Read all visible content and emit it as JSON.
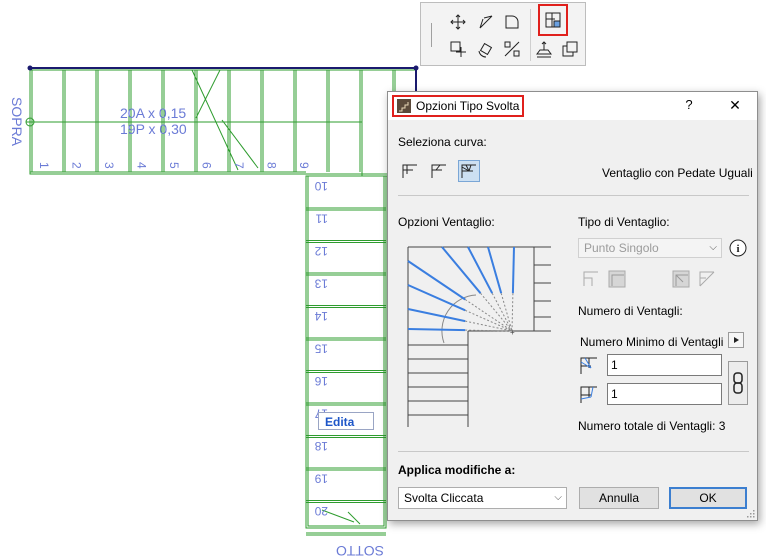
{
  "canvas": {
    "stair_label_top": "SOPRA",
    "stair_label_bottom": "SOTTO",
    "dim_riser": "20A x 0,15",
    "dim_tread": "19P x 0,30",
    "step_numbers": [
      "1",
      "2",
      "3",
      "4",
      "5",
      "6",
      "7",
      "8",
      "9",
      "10",
      "11",
      "12",
      "13",
      "14",
      "15",
      "16",
      "17",
      "18",
      "19",
      "20"
    ],
    "edit_tooltip": "Edita",
    "colors": {
      "stair_line": "#2e9c2e",
      "label": "#6b7bd6",
      "edge": "#1a1a6e"
    }
  },
  "toolbar": {
    "buttons": [
      "move-icon",
      "drag-rotate-icon",
      "curve-edit-icon",
      "turn-options-icon",
      "offset-icon",
      "rotate-icon",
      "split-icon",
      "elevate-icon",
      "copy-icon"
    ],
    "highlighted": "turn-options-icon"
  },
  "dialog": {
    "title": "Opzioni Tipo Svolta",
    "help_label": "?",
    "close_label": "✕",
    "select_curve_label": "Seleziona curva:",
    "curve_type_value": "Ventaglio con Pedate Uguali",
    "fan_options_label": "Opzioni Ventaglio:",
    "fan_type_label": "Tipo di Ventaglio:",
    "fan_type_value": "Punto Singolo",
    "info_icon": "i",
    "fan_count_label": "Numero di Ventagli:",
    "min_fan_label": "Numero Minimo di Ventagli",
    "fan_count_1": "1",
    "fan_count_2": "1",
    "total_fans_label": "Numero totale di Ventagli: 3",
    "apply_label": "Applica modifiche a:",
    "apply_value": "Svolta Cliccata",
    "cancel_label": "Annulla",
    "ok_label": "OK",
    "colors": {
      "highlight": "#e0201c",
      "fan_line": "#3a7ee0",
      "selected_bg": "#cde0f2"
    }
  }
}
